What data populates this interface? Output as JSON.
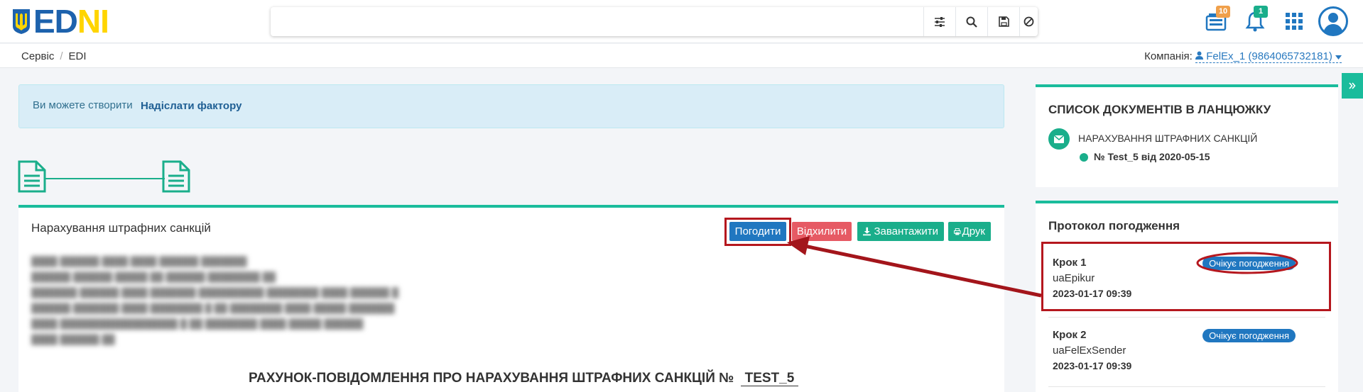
{
  "header": {
    "logo_text_a": "ED",
    "logo_text_b": "N",
    "logo_text_c": "I",
    "search_placeholder": "",
    "search_buttons": [
      "filter-icon",
      "search-icon",
      "save-icon",
      "clear-icon"
    ],
    "archive_badge": "10",
    "notifications_badge": "1"
  },
  "breadcrumb": {
    "items": [
      "Сервіс",
      "EDI"
    ]
  },
  "company": {
    "label": "Компанія:",
    "value": "FelEx_1 (9864065732181)"
  },
  "alert": {
    "text": "Ви можете створити",
    "link": "Надіслати фактору"
  },
  "document": {
    "title": "Нарахування штрафних санкцій",
    "buttons": {
      "approve": "Погодити",
      "reject": "Відхилити",
      "download": "Завантажити",
      "print": "Друк"
    },
    "heading": "РАХУНОК-ПОВІДОМЛЕННЯ ПРО НАРАХУВАННЯ ШТРАФНИХ САНКЦІЙ №",
    "number": "TEST_5"
  },
  "chain_panel": {
    "title": "СПИСОК ДОКУМЕНТІВ В ЛАНЦЮЖКУ",
    "item_name": "НАРАХУВАННЯ ШТРАФНИХ САНКЦІЙ",
    "item_number": "№ Test_5 від 2020-05-15"
  },
  "protocol": {
    "title": "Протокол погодження",
    "steps": [
      {
        "name": "Крок 1",
        "user": "uaEpikur",
        "date": "2023-01-17 09:39",
        "status": "Очікує погодження"
      },
      {
        "name": "Крок 2",
        "user": "uaFelExSender",
        "date": "2023-01-17 09:39",
        "status": "Очікує погодження"
      }
    ]
  },
  "colors": {
    "brand_blue": "#1d62ad",
    "brand_yellow": "#ffd500",
    "accent_green": "#1abc9c",
    "primary": "#2077c0",
    "danger": "#e65a64",
    "highlight_red": "#b5171e"
  }
}
